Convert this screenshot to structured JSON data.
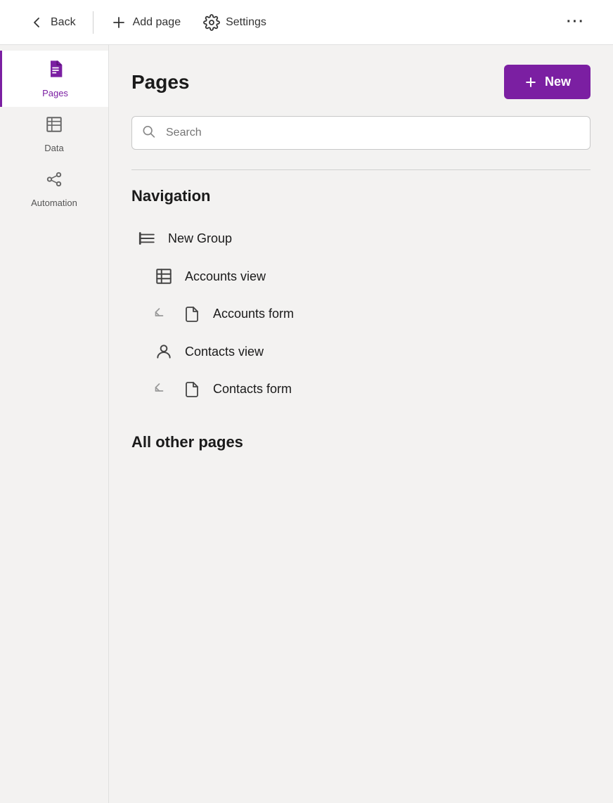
{
  "toolbar": {
    "back_label": "Back",
    "add_page_label": "Add page",
    "settings_label": "Settings",
    "more_label": "···"
  },
  "sidebar": {
    "items": [
      {
        "id": "pages",
        "label": "Pages",
        "active": true
      },
      {
        "id": "data",
        "label": "Data",
        "active": false
      },
      {
        "id": "automation",
        "label": "Automation",
        "active": false
      }
    ]
  },
  "content": {
    "title": "Pages",
    "new_button_label": "New",
    "search_placeholder": "Search",
    "navigation_heading": "Navigation",
    "all_other_pages_heading": "All other pages",
    "nav_items": [
      {
        "id": "new-group",
        "label": "New Group",
        "icon": "group",
        "indented": false
      },
      {
        "id": "accounts-view",
        "label": "Accounts view",
        "icon": "table",
        "indented": true,
        "sub": false
      },
      {
        "id": "accounts-form",
        "label": "Accounts form",
        "icon": "doc",
        "indented": true,
        "sub": true
      },
      {
        "id": "contacts-view",
        "label": "Contacts view",
        "icon": "person",
        "indented": true,
        "sub": false
      },
      {
        "id": "contacts-form",
        "label": "Contacts form",
        "icon": "doc",
        "indented": true,
        "sub": true
      }
    ]
  },
  "colors": {
    "accent": "#7b1fa2",
    "accent_hover": "#6a1791"
  }
}
